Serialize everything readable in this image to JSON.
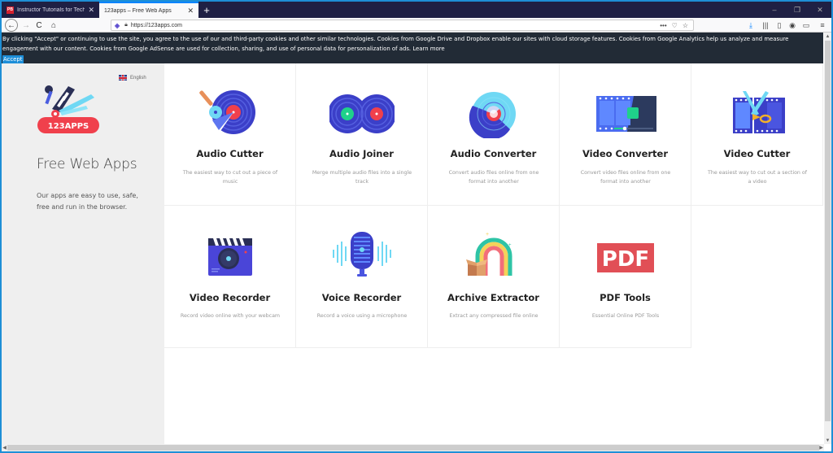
{
  "browser": {
    "tabs": [
      {
        "label": "Instructor Tutorials for Technol",
        "favicon": "PB",
        "active": false
      },
      {
        "label": "123apps – Free Web Apps",
        "active": true
      }
    ],
    "new_tab": "+",
    "window_controls": {
      "minimize": "–",
      "restore": "❐",
      "close": "✕"
    },
    "url": "https://123apps.com",
    "icons": {
      "back": "←",
      "forward": "→",
      "reload": "C",
      "home": "⌂",
      "more": "•••",
      "pocket": "♡",
      "star": "☆",
      "download": "⤓",
      "library": "|||",
      "sidebar": "▯",
      "account": "◉",
      "notes": "▭",
      "menu": "≡"
    }
  },
  "cookie_banner": {
    "text": "By clicking \"Accept\" or continuing to use the site, you agree to the use of our and third-party cookies and other similar technologies. Cookies from Google Drive and Dropbox enable our sites with cloud storage features. Cookies from Google Analytics help us analyze and measure engagement with our content. Cookies from Google AdSense are used for collection, sharing, and use of personal data for personalization of ads.",
    "learn_more": "Learn more",
    "accept": "Accept"
  },
  "sidebar": {
    "language": "English",
    "logo_text": "123APPS",
    "title": "Free Web Apps",
    "description": "Our apps are easy to use, safe, free and run in the browser."
  },
  "apps": [
    {
      "title": "Audio Cutter",
      "description": "The easiest way to cut out a piece of music"
    },
    {
      "title": "Audio Joiner",
      "description": "Merge multiple audio files into a single track"
    },
    {
      "title": "Audio Converter",
      "description": "Convert audio files online from one format into another"
    },
    {
      "title": "Video Converter",
      "description": "Convert video files online from one format into another"
    },
    {
      "title": "Video Cutter",
      "description": "The easiest way to cut out a section of a video"
    },
    {
      "title": "Video Recorder",
      "description": "Record video online with your webcam"
    },
    {
      "title": "Voice Recorder",
      "description": "Record a voice using a microphone"
    },
    {
      "title": "Archive Extractor",
      "description": "Extract any compressed file online"
    },
    {
      "title": "PDF Tools",
      "description": "Essential Online PDF Tools",
      "icon_text": "PDF"
    }
  ],
  "colors": {
    "accent": "#1d8ed8",
    "banner_bg": "#222b36",
    "logo_red": "#f0404c",
    "vinyl_blue": "#3b3fc8"
  }
}
